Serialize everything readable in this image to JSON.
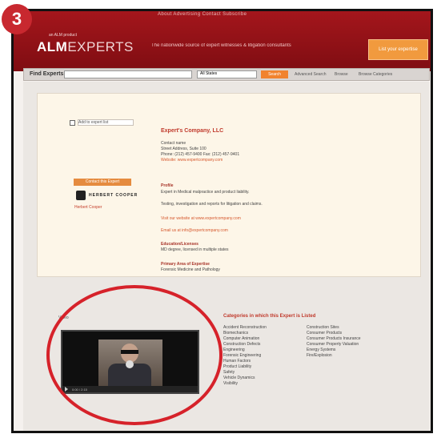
{
  "step_badge": "3",
  "header": {
    "top_links": "About   Advertising   Contact   Subscribe",
    "logo_prefix": "ALM",
    "logo_suffix": "EXPERTS",
    "logo_sup": "an ALM product",
    "tagline": "The nationwide source of expert witnesses & litigation consultants",
    "cta": "List your expertise"
  },
  "search": {
    "find_label": "Find Experts",
    "input_value": "",
    "select_value": "All States",
    "go_label": "Search",
    "links": [
      "Advanced Search",
      "Browse",
      "Browse Categories"
    ]
  },
  "profile": {
    "checkbox_label": "Add to expert list",
    "contact_button": "Contact this Expert",
    "firm_logo": "HERBERT\nCOOPER",
    "firm_line": "Herbert Cooper",
    "name": "Expert's Company, LLC",
    "address": [
      "Contact name",
      "Street Address, Suite 100",
      "Phone: (212) 457-9400   Fax: (212) 457-9401",
      "Website: www.expertcompany.com"
    ],
    "profile_title": "Profile",
    "profile_lines": [
      "Expert in Medical malpractice and product liability.",
      "Testing, investigation and reports for litigation and claims.",
      "Visit our website at www.expertcompany.com",
      "Email us at info@expertcompany.com"
    ],
    "education_title": "Education/Licenses",
    "education_text": "MD degree, licensed in multiple states",
    "areas_title": "Primary Area of Expertise",
    "areas_text": "Forensic Medicine and Pathology"
  },
  "video": {
    "label": "Video",
    "time": "0:00 / 2:15"
  },
  "categories": {
    "title": "Categories in which this Expert is Listed",
    "col1": [
      "Accident Reconstruction",
      "Biomechanics",
      "Computer Animation",
      "Construction Defects",
      "Engineering",
      "Forensic Engineering",
      "Human Factors",
      "Product Liability",
      "Safety",
      "Vehicle Dynamics",
      "Visibility"
    ],
    "col2": [
      "Construction Sites",
      "Consumer Products",
      "Consumer Products Insurance",
      "Consumer Property Valuation",
      "Energy Systems",
      "Fire/Explosion"
    ]
  }
}
